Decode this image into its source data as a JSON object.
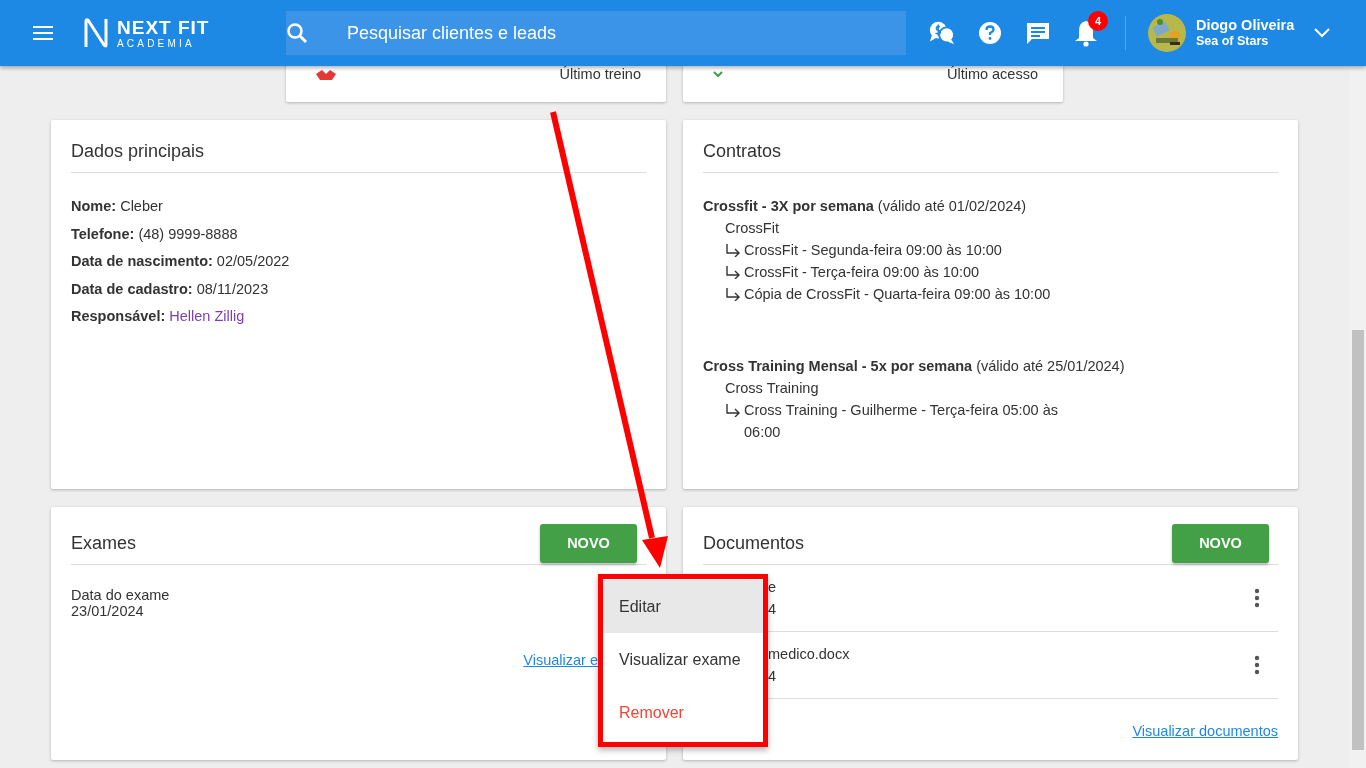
{
  "header": {
    "logo_title": "NEXT FIT",
    "logo_subtitle": "ACADEMIA",
    "search": {
      "placeholder": "Pesquisar clientes e leads"
    },
    "notifications_badge": "4",
    "user": {
      "name": "Diogo Oliveira",
      "subtitle": "Sea of Stars"
    }
  },
  "summary_cards": [
    {
      "label": "Último treino",
      "kind": "alert"
    },
    {
      "label": "Último acesso",
      "kind": "ok"
    }
  ],
  "dados_principais": {
    "title": "Dados principais",
    "fields": [
      {
        "label": "Nome:",
        "value": "Cleber",
        "link": false
      },
      {
        "label": "Telefone:",
        "value": "(48) 9999-8888",
        "link": false
      },
      {
        "label": "Data de nascimento:",
        "value": "02/05/2022",
        "link": false
      },
      {
        "label": "Data de cadastro:",
        "value": "08/11/2023",
        "link": false
      },
      {
        "label": "Responsável:",
        "value": "Hellen Zillig",
        "link": true
      }
    ]
  },
  "contratos": {
    "title": "Contratos",
    "items": [
      {
        "heading": "**Crossfit - 3X por semana** (válido até 01/02/2024)",
        "modality": "CrossFit",
        "schedules": [
          "CrossFit - Segunda-feira 09:00 às 10:00",
          "CrossFit - Terça-feira 09:00 às 10:00",
          "Cópia de CrossFit - Quarta-feira 09:00 às 10:00"
        ]
      },
      {
        "heading": "**Cross Training Mensal - 5x por semana** (válido até 25/01/2024)",
        "modality": "Cross Training",
        "schedules": [
          "Cross Training - Guilherme - Terça-feira 05:00 às 06:00"
        ]
      }
    ]
  },
  "exames": {
    "title": "Exames",
    "new_button": "NOVO",
    "items": [
      {
        "label": "Data do exame",
        "date": "23/01/2024"
      }
    ],
    "link": "Visualizar e"
  },
  "documentos": {
    "title": "Documentos",
    "new_button": "NOVO",
    "items": [
      {
        "name": "e",
        "date": "4"
      },
      {
        "name": "medico.docx",
        "date": "4"
      }
    ],
    "link": "Visualizar documentos"
  },
  "context_menu": {
    "items": [
      {
        "label": "Editar",
        "kind": "normal",
        "selected": true
      },
      {
        "label": "Visualizar exame",
        "kind": "normal",
        "selected": false
      },
      {
        "label": "Remover",
        "kind": "danger",
        "selected": false
      }
    ]
  }
}
